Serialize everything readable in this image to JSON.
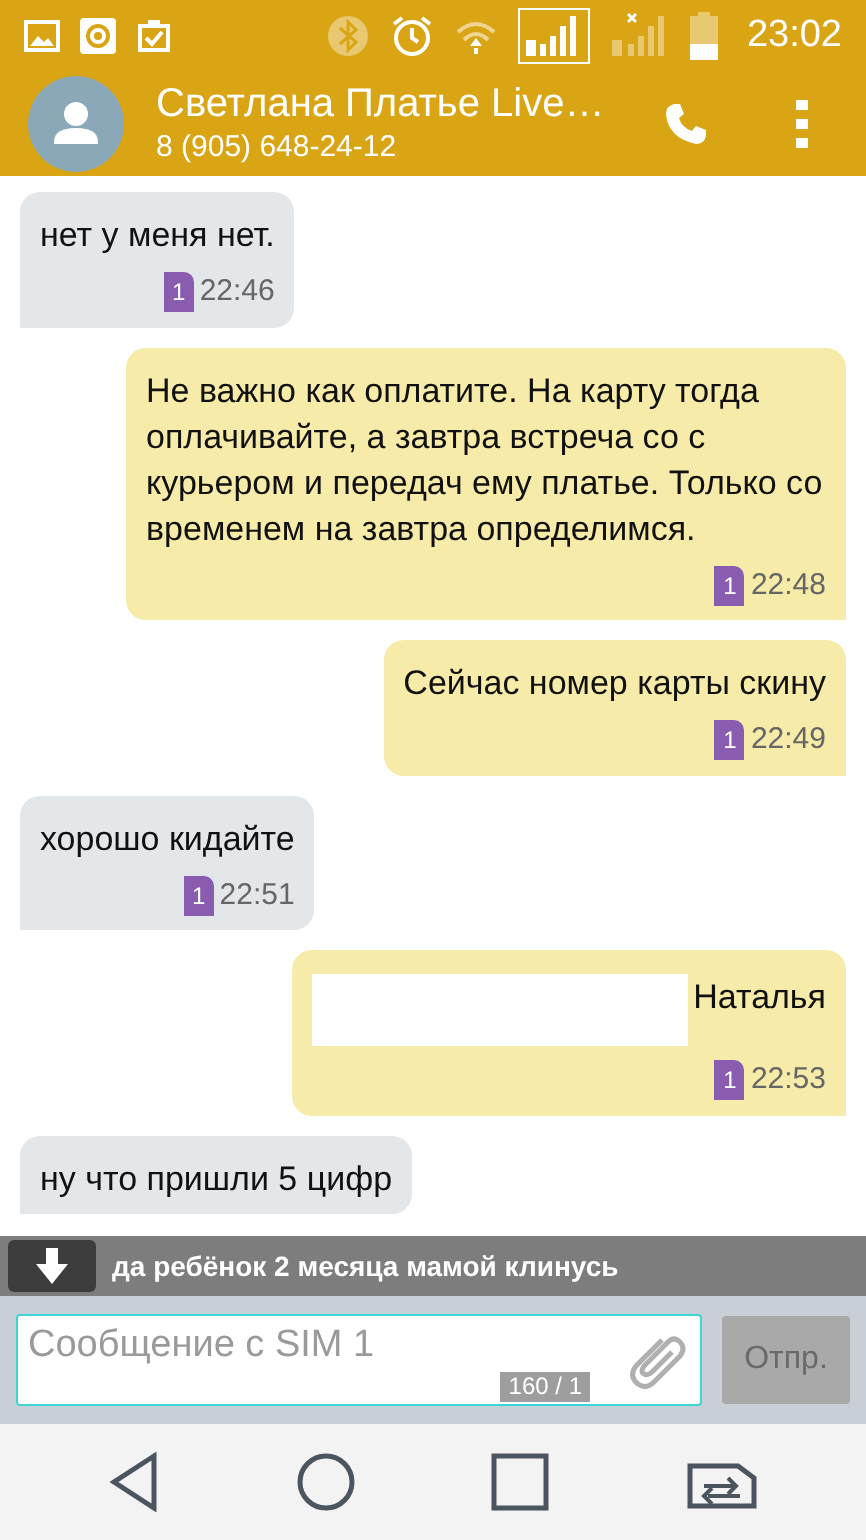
{
  "status_bar": {
    "time": "23:02"
  },
  "contact": {
    "name": "Светлана Платье Live…",
    "phone": "8 (905) 648-24-12"
  },
  "messages": [
    {
      "kind": "incoming",
      "text": "нет у меня нет.",
      "sim": "1",
      "time": "22:46"
    },
    {
      "kind": "outgoing",
      "text": "Не важно как оплатите. На карту тогда оплачивайте, а завтра встреча со с курьером и передач ему платье. Только со временем на завтра определимся.",
      "sim": "1",
      "time": "22:48"
    },
    {
      "kind": "outgoing",
      "text": "Сейчас номер карты скину",
      "sim": "1",
      "time": "22:49"
    },
    {
      "kind": "incoming",
      "text": "хорошо кидайте",
      "sim": "1",
      "time": "22:51"
    },
    {
      "kind": "outgoing",
      "redacted": true,
      "text": "Наталья",
      "sim": "1",
      "time": "22:53"
    },
    {
      "kind": "incoming",
      "text": "ну что пришли 5 цифр"
    }
  ],
  "notification": {
    "text": "да ребёнок 2 месяца мамой клинусь"
  },
  "composer": {
    "placeholder": "Сообщение с SIM 1",
    "counter": "160 / 1",
    "send": "Отпр."
  }
}
